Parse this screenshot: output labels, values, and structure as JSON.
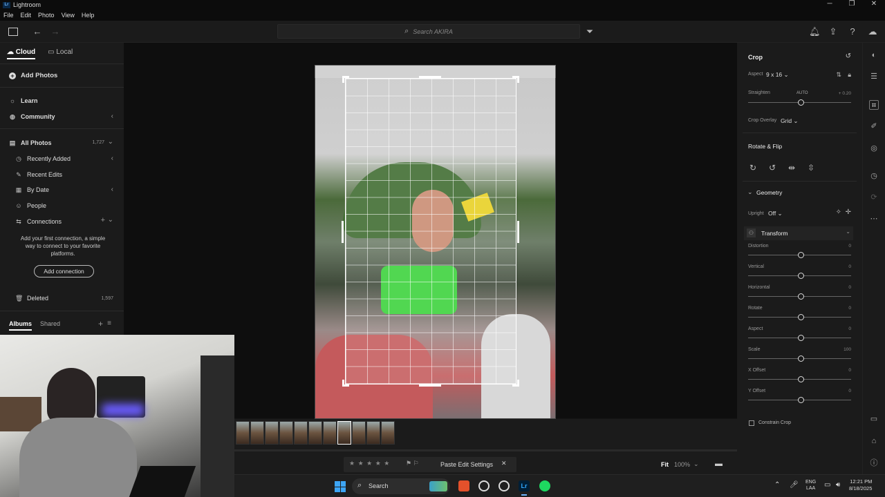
{
  "window": {
    "app_icon": "Lr",
    "title": "Lightroom",
    "min": "─",
    "max": "❐",
    "close": "✕"
  },
  "menu": [
    "File",
    "Edit",
    "Photo",
    "View",
    "Help"
  ],
  "toolbar": {
    "search_placeholder": "Search AKIRA"
  },
  "left": {
    "tab_cloud": "Cloud",
    "tab_local": "Local",
    "add_photos": "Add Photos",
    "learn": "Learn",
    "community": "Community",
    "all_photos": "All Photos",
    "all_photos_count": "1,727",
    "recently_added": "Recently Added",
    "recent_edits": "Recent Edits",
    "by_date": "By Date",
    "people": "People",
    "connections": "Connections",
    "conn_msg": "Add your first connection, a simple way to connect to your favorite platforms.",
    "add_connection": "Add connection",
    "deleted": "Deleted",
    "deleted_count": "1,597",
    "albums": "Albums",
    "shared": "Shared"
  },
  "crop": {
    "title": "Crop",
    "aspect_label": "Aspect",
    "aspect_value": "9 x 16",
    "straighten_label": "Straighten",
    "straighten_auto": "AUTO",
    "straighten_value": "+ 0.20",
    "overlay_label": "Crop Overlay",
    "overlay_value": "Grid",
    "rotate_flip": "Rotate & Flip"
  },
  "geometry": {
    "title": "Geometry",
    "upright_label": "Upright",
    "upright_value": "Off",
    "transform": "Transform",
    "sliders": [
      {
        "label": "Distortion",
        "value": "0"
      },
      {
        "label": "Vertical",
        "value": "0"
      },
      {
        "label": "Horizontal",
        "value": "0"
      },
      {
        "label": "Rotate",
        "value": "0"
      },
      {
        "label": "Aspect",
        "value": "0"
      },
      {
        "label": "Scale",
        "value": "100"
      },
      {
        "label": "X Offset",
        "value": "0"
      },
      {
        "label": "Y Offset",
        "value": "0"
      }
    ],
    "constrain_crop": "Constrain Crop"
  },
  "bottom": {
    "stars": "★ ★ ★ ★ ★",
    "paste_edit": "Paste Edit Settings",
    "fit": "Fit",
    "zoom": "100%"
  },
  "taskbar": {
    "search": "Search",
    "lang": "ENG",
    "lang2": "LAA",
    "time": "12:21 PM",
    "date": "8/18/2025"
  },
  "colors": {
    "accent": "#6fb6ff",
    "panel": "#1b1b1b",
    "bg": "#0e0e0e"
  }
}
